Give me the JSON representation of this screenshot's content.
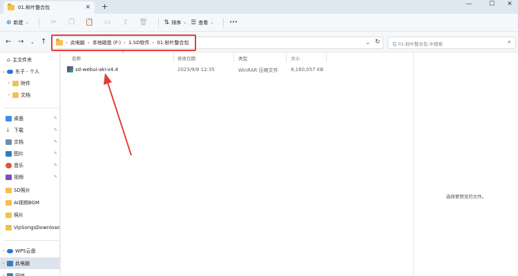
{
  "tab": {
    "title": "01.秋叶整合包"
  },
  "window": {
    "minimize": "—",
    "maximize": "☐",
    "close": "✕"
  },
  "toolbar": {
    "new_label": "新建",
    "sort_label": "排序",
    "view_label": "查看",
    "more_label": "···"
  },
  "address": {
    "crumbs": [
      "此电脑",
      "本地磁盘 (F:)",
      "1.SD软件",
      "01.秋叶整合包"
    ],
    "search_placeholder": "在 01.秋叶整合包 中搜索"
  },
  "sidebar": {
    "top": [
      {
        "label": "主文件夹"
      },
      {
        "label": "东子 - 个人"
      },
      {
        "label": "附件"
      },
      {
        "label": "文档"
      }
    ],
    "quick": [
      {
        "label": "桌面"
      },
      {
        "label": "下载"
      },
      {
        "label": "文档"
      },
      {
        "label": "图片"
      },
      {
        "label": "音乐"
      },
      {
        "label": "视频"
      },
      {
        "label": "SD照片"
      },
      {
        "label": "AI视频BGM"
      },
      {
        "label": "照片"
      },
      {
        "label": "VipSongsDownload"
      }
    ],
    "bottom": [
      {
        "label": "WPS云盘"
      },
      {
        "label": "此电脑"
      },
      {
        "label": "网络"
      }
    ]
  },
  "columns": {
    "name": "名称",
    "modified": "修改日期",
    "type": "类型",
    "size": "大小"
  },
  "files": [
    {
      "name": "sd-webui-aki-v4.4",
      "modified": "2023/9/8 12:35",
      "type": "WinRAR 压缩文件",
      "size": "8,160,057 KB"
    }
  ],
  "preview": {
    "message": "选择要预览的文件。"
  },
  "colors": {
    "highlight": "#e53935",
    "accent": "#2a6fb5"
  }
}
